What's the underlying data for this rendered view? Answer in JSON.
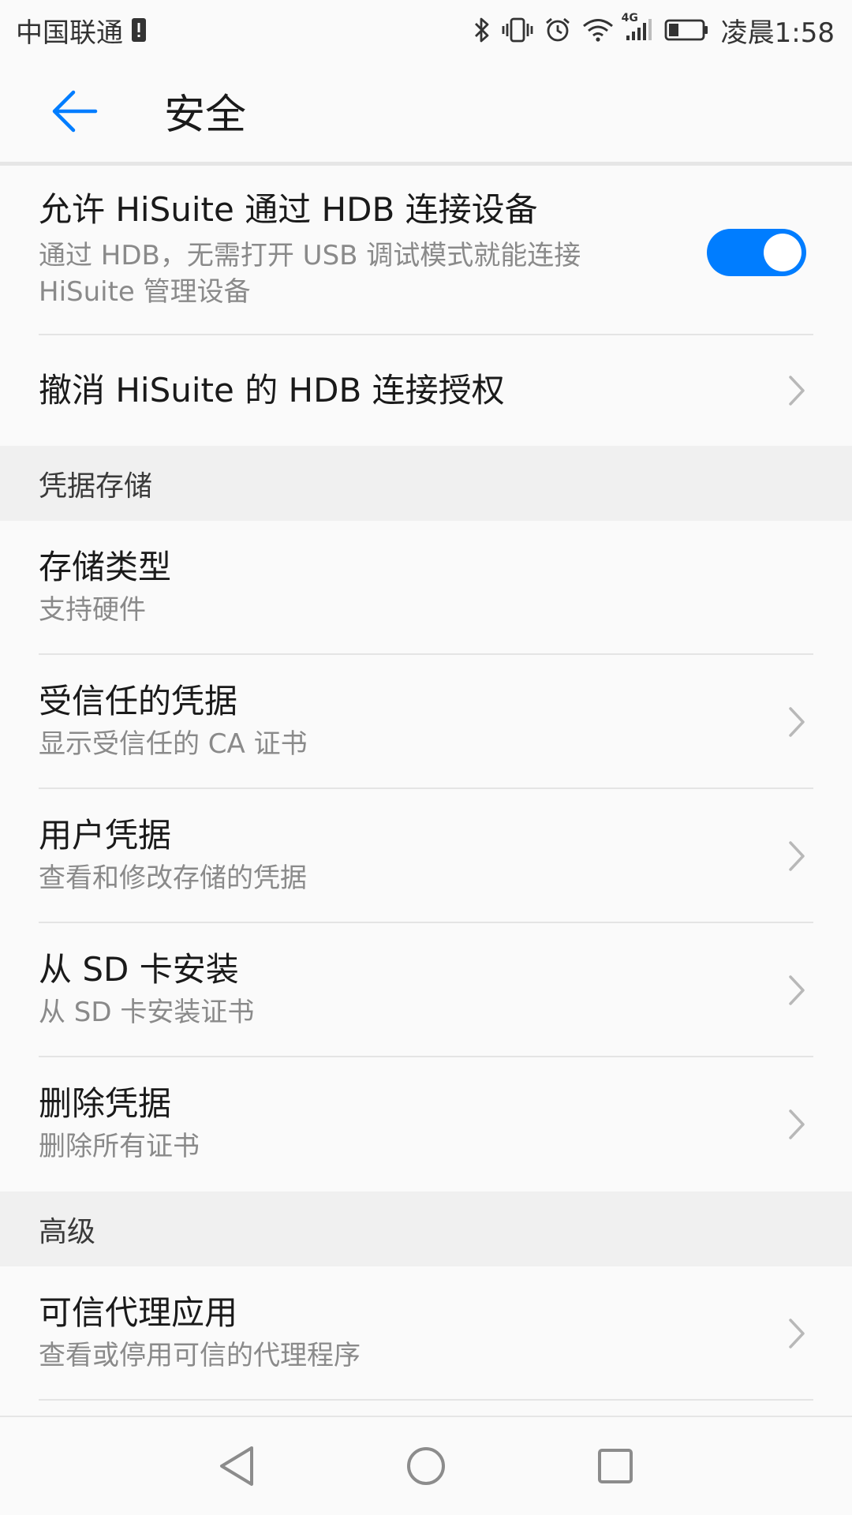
{
  "status_bar": {
    "carrier": "中国联通",
    "time": "凌晨1:58",
    "network_label": "4G",
    "icons": [
      "sim-alert-icon",
      "bluetooth-icon",
      "vibrate-icon",
      "alarm-icon",
      "wifi-icon",
      "signal-icon",
      "battery-icon"
    ]
  },
  "header": {
    "title": "安全",
    "back_icon": "back-arrow-icon"
  },
  "hdb": {
    "allow_title": "允许 HiSuite 通过 HDB 连接设备",
    "allow_sub_line1": "通过 HDB，无需打开 USB 调试模式就能连接",
    "allow_sub_line2": "HiSuite 管理设备",
    "allow_enabled": true,
    "revoke_title": "撤消 HiSuite 的 HDB 连接授权"
  },
  "credential_storage": {
    "section_label": "凭据存储",
    "items": [
      {
        "title": "存储类型",
        "subtitle": "支持硬件",
        "chevron": false
      },
      {
        "title": "受信任的凭据",
        "subtitle": "显示受信任的 CA 证书",
        "chevron": true
      },
      {
        "title": "用户凭据",
        "subtitle": "查看和修改存储的凭据",
        "chevron": true
      },
      {
        "title": "从 SD 卡安装",
        "subtitle": "从 SD 卡安装证书",
        "chevron": true
      },
      {
        "title": "删除凭据",
        "subtitle": "删除所有证书",
        "chevron": true
      }
    ]
  },
  "advanced": {
    "section_label": "高级",
    "items": [
      {
        "title": "可信代理应用",
        "subtitle": "查看或停用可信的代理程序",
        "chevron": true
      }
    ]
  },
  "nav_bar": {
    "icons": [
      "back-triangle-icon",
      "home-circle-icon",
      "recents-square-icon"
    ]
  },
  "colors": {
    "accent": "#007dff",
    "background": "#fafafa",
    "section_bg": "#f0f0f0",
    "divider": "#e4e4e4"
  }
}
